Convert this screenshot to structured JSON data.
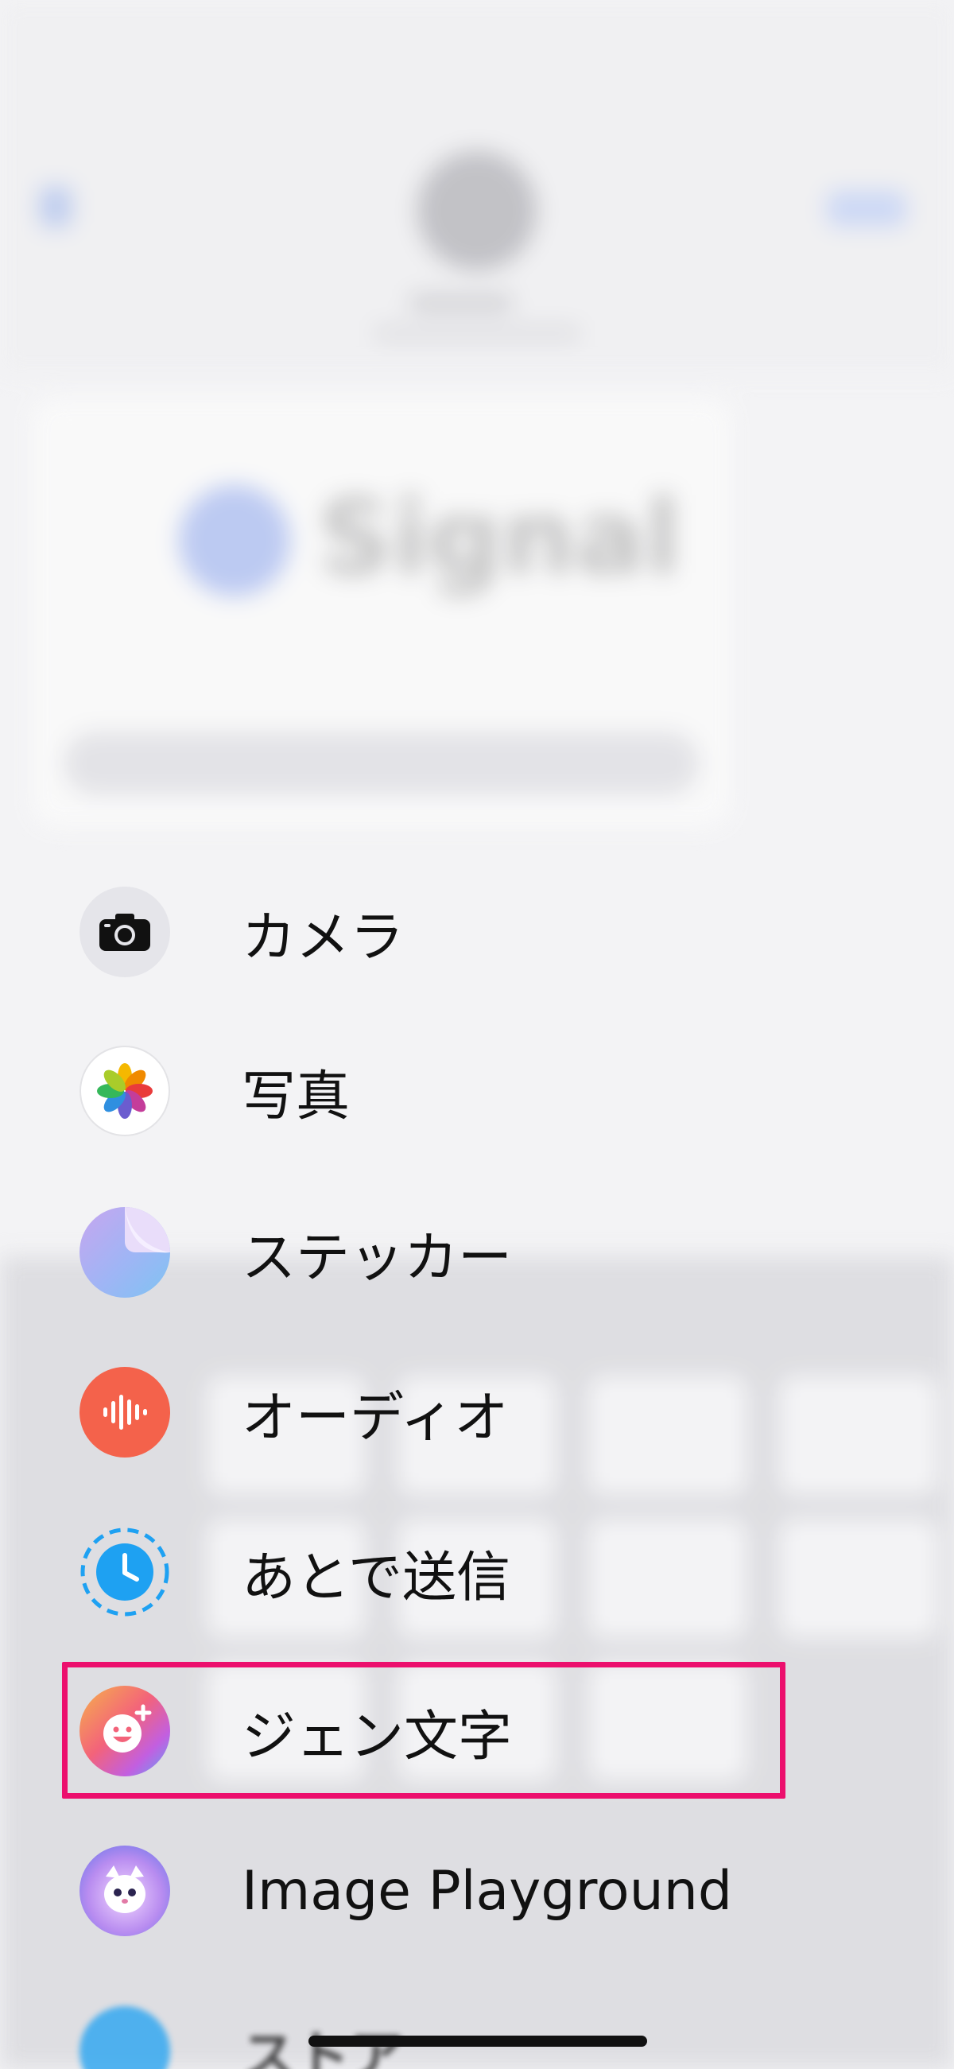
{
  "background": {
    "signal_text": "Signal"
  },
  "menu": {
    "items": [
      {
        "label": "カメラ",
        "icon": "camera-icon"
      },
      {
        "label": "写真",
        "icon": "photos-icon"
      },
      {
        "label": "ステッカー",
        "icon": "stickers-icon"
      },
      {
        "label": "オーディオ",
        "icon": "audio-icon"
      },
      {
        "label": "あとで送信",
        "icon": "send-later-icon"
      },
      {
        "label": "ジェン文字",
        "icon": "genmoji-icon"
      },
      {
        "label": "Image Playground",
        "icon": "image-playground-icon"
      },
      {
        "label": "ストア",
        "icon": "store-icon"
      }
    ],
    "highlighted_item": "ジェン文字"
  },
  "colors": {
    "highlight": "#ec0f6d",
    "audio": "#f4624b",
    "send_later": "#1ea1f2"
  }
}
